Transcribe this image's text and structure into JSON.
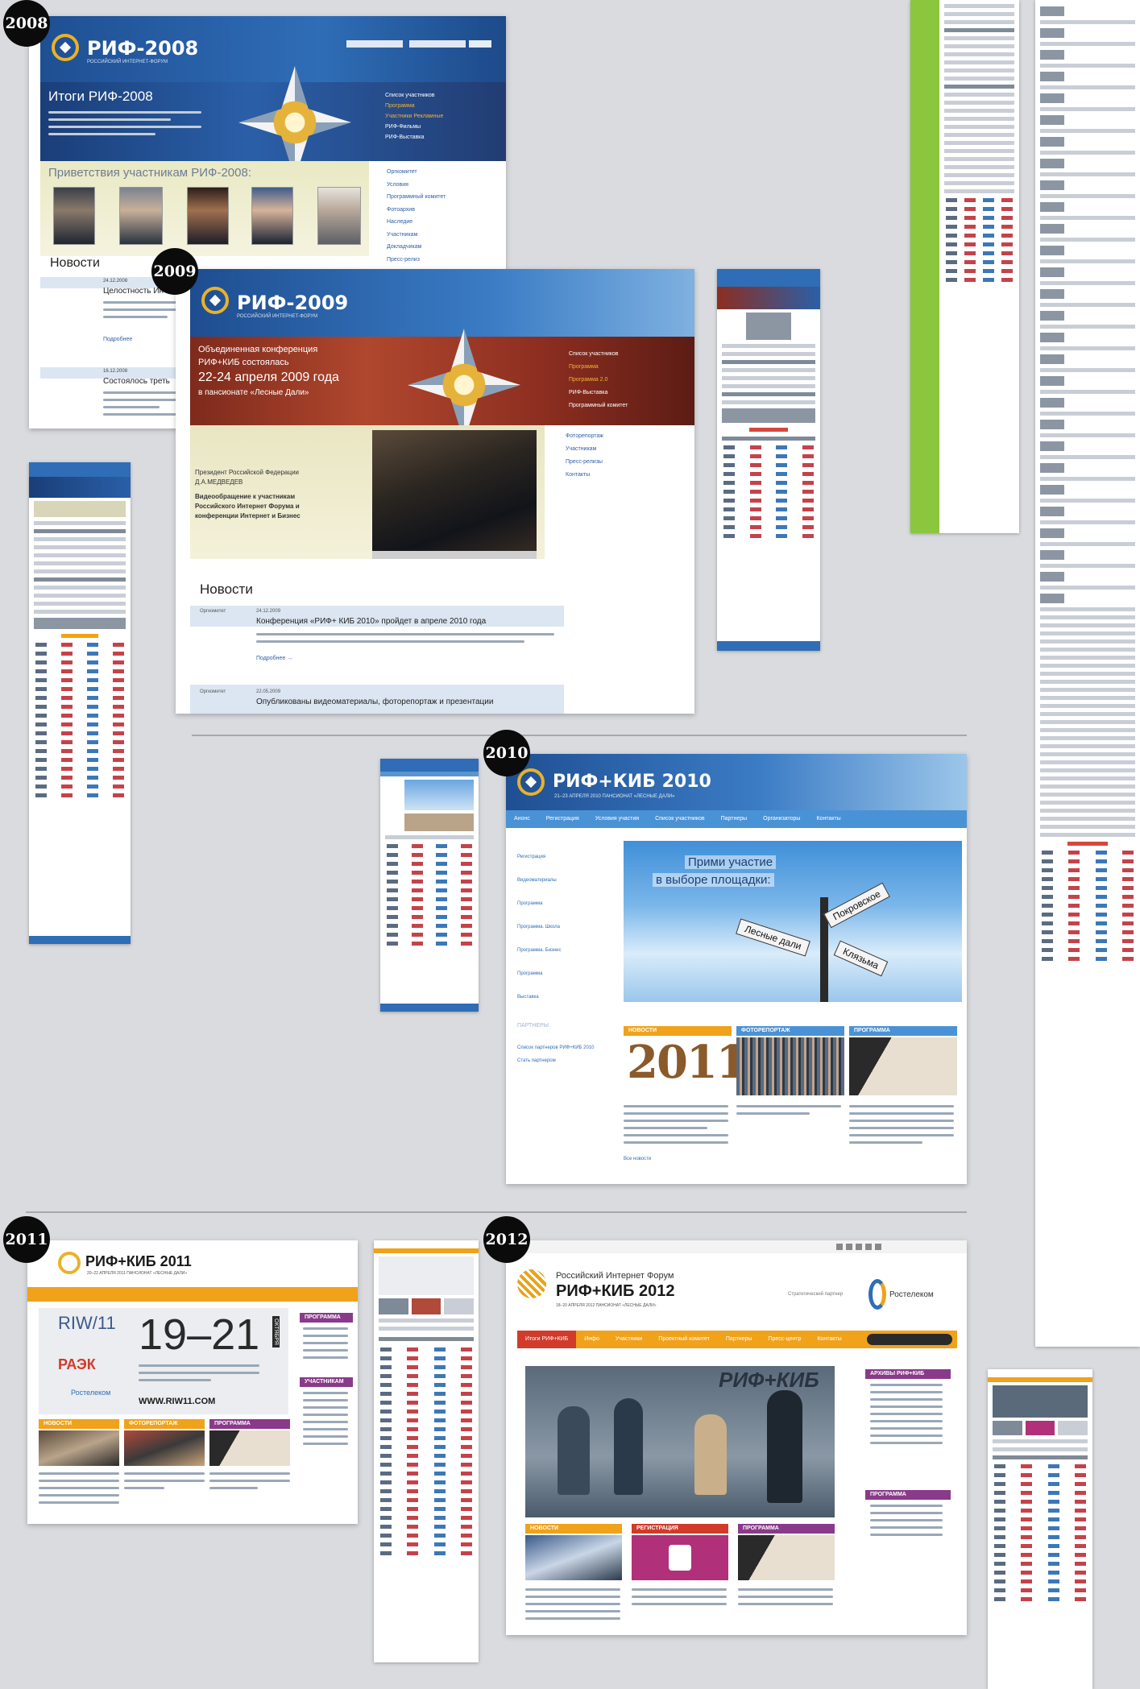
{
  "years": {
    "y2008": "2008",
    "y2009": "2009",
    "y2010": "2010",
    "y2011": "2011",
    "y2012": "2012"
  },
  "s2008": {
    "logo": "РИФ-2008",
    "logo_sub": "РОССИЙСКИЙ ИНТЕРНЕТ-ФОРУМ",
    "headline": "Итоги РИФ-2008",
    "greetings": "Приветствия участникам РИФ-2008:",
    "news": "Новости",
    "news1_date": "24.12.2008",
    "news1_title": "Целостность Ин",
    "news2_date": "16.12.2008",
    "news2_title": "Состоялось треть",
    "more": "Подробнее",
    "right_links": [
      "Список участников",
      "Программа",
      "Участники Рекламные",
      "РИФ-Фильмы",
      "РИФ-Выставка"
    ],
    "side_links": [
      "Оргкомитет",
      "Условия",
      "Программный комитет",
      "Фотоархив",
      "Наследие",
      "Участникам",
      "Докладчикам",
      "Пресс-релиз"
    ]
  },
  "s2009": {
    "logo": "РИФ-2009",
    "logo_sub": "РОССИЙСКИЙ ИНТЕРНЕТ-ФОРУМ",
    "banner_l1": "Объединенная конференция",
    "banner_l2": "РИФ+КИБ состоялась",
    "banner_l3": "22-24 апреля 2009 года",
    "banner_l4": "в пансионате «Лесные Дали»",
    "right_links": [
      "Список участников",
      "Программа",
      "Программа 2.0",
      "РИФ-Выставка",
      "Программный комитет"
    ],
    "video_l1": "Президент Российской Федерации",
    "video_l2": "Д.А.МЕДВЕДЕВ",
    "video_l3": "Видеообращение к участникам",
    "video_l4": "Российского Интернет Форума и",
    "video_l5": "конференции Интернет и Бизнес",
    "side_links": [
      "Фоторепортаж",
      "Участникам",
      "Пресс-релизы",
      "Контакты"
    ],
    "news": "Новости",
    "n1_src": "Оргкомитет",
    "n1_date": "24.12.2009",
    "n1_title": "Конференция «РИФ+ КИБ 2010» пройдет в апреле 2010 года",
    "n1_more": "Подробнее →",
    "n2_src": "Оргкомитет",
    "n2_date": "22.05.2009",
    "n2_title": "Опубликованы видеоматериалы, фоторепортаж и презентации"
  },
  "s2010": {
    "logo": "РИФ+КИБ 2010",
    "logo_sub": "21–23 АПРЕЛЯ 2010  ПАНСИОНАТ «ЛЕСНЫЕ ДАЛИ»",
    "nav": [
      "Анонс",
      "Регистрация",
      "Условия участия",
      "Список участников",
      "Партнеры",
      "Организаторы",
      "Контакты"
    ],
    "side_links": [
      "Регистрация",
      "Видеоматериалы",
      "Программа",
      "Программа. Школа",
      "Программа. Бизнес",
      "Программа",
      "Выставка"
    ],
    "side_block_head": "ПАРТНЕРЫ",
    "side_block_link1": "Список партнеров РИФ+КИБ 2010",
    "side_block_link2": "Стать партнером",
    "banner_l1": "Прими участие",
    "banner_l2": "в выборе площадки:",
    "sign1": "Лесные дали",
    "sign2": "Покровское",
    "sign3": "Клязьма",
    "col1_head": "НОВОСТИ",
    "col2_head": "ФОТОРЕПОРТАЖ",
    "col3_head": "ПРОГРАММА",
    "big_year": "2011",
    "all_news": "Все новости"
  },
  "s2011": {
    "logo": "РИФ+КИБ 2011",
    "logo_sub": "20–22 АПРЕЛЯ 2011  ПАНСИОНАТ «ЛЕСНЫЕ ДАЛИ»",
    "riw": "RIW/11",
    "dates": "19–21",
    "month": "ОКТЯБРЯ",
    "raek": "РАЭК",
    "rostelecom": "Ростелеком",
    "site": "WWW.RIW11.COM",
    "col1": "НОВОСТИ",
    "col2": "ФОТОРЕПОРТАЖ",
    "col3": "ПРОГРАММА",
    "side_head1": "ПРОГРАММА",
    "side_head2": "УЧАСТНИКАМ"
  },
  "s2012": {
    "forum_line": "Российский Интернет Форум",
    "logo": "РИФ+КИБ 2012",
    "logo_sub": "18–20 АПРЕЛЯ 2012  ПАНСИОНАТ «ЛЕСНЫЕ ДАЛИ»",
    "partner_label": "Стратегический партнер",
    "partner": "Ростелеком",
    "nav": [
      "Итоги РИФ+КИБ",
      "Инфо",
      "Участники",
      "Проектный комитет",
      "Партнеры",
      "Пресс-центр",
      "Контакты"
    ],
    "side_head1": "АРХИВЫ РИФ+КИБ",
    "side_head2": "ПРОГРАММА",
    "col1": "НОВОСТИ",
    "col2": "РЕГИСТРАЦИЯ",
    "col3": "ПРОГРАММА",
    "banner_word": "РИФ+КИБ"
  }
}
